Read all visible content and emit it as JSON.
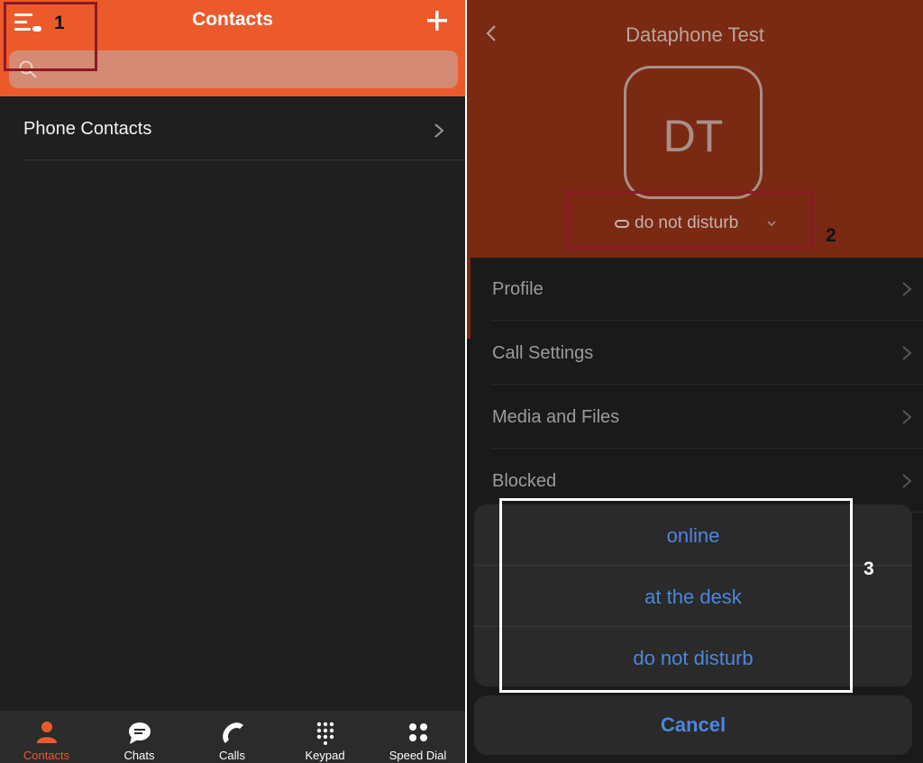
{
  "left": {
    "header": {
      "title": "Contacts",
      "menu_icon": "menu-icon",
      "add_icon": "plus-icon",
      "color": "#ec5a2c"
    },
    "search": {
      "placeholder": ""
    },
    "list": [
      {
        "label": "Phone Contacts"
      }
    ],
    "tabs": [
      {
        "label": "Contacts",
        "icon": "person-icon",
        "active": true
      },
      {
        "label": "Chats",
        "icon": "chat-bubble-icon",
        "active": false
      },
      {
        "label": "Calls",
        "icon": "phone-icon",
        "active": false
      },
      {
        "label": "Keypad",
        "icon": "keypad-icon",
        "active": false
      },
      {
        "label": "Speed Dial",
        "icon": "speed-dial-icon",
        "active": false
      }
    ]
  },
  "right": {
    "header": {
      "title": "Dataphone Test",
      "initials": "DT",
      "status": "do not disturb"
    },
    "menu": [
      {
        "label": "Profile"
      },
      {
        "label": "Call Settings"
      },
      {
        "label": "Media and Files"
      },
      {
        "label": "Blocked"
      }
    ],
    "status_sheet": {
      "options": [
        "online",
        "at the desk",
        "do not disturb"
      ],
      "cancel": "Cancel",
      "accent": "#4e86dd"
    }
  },
  "annotations": [
    "1",
    "2",
    "3"
  ]
}
